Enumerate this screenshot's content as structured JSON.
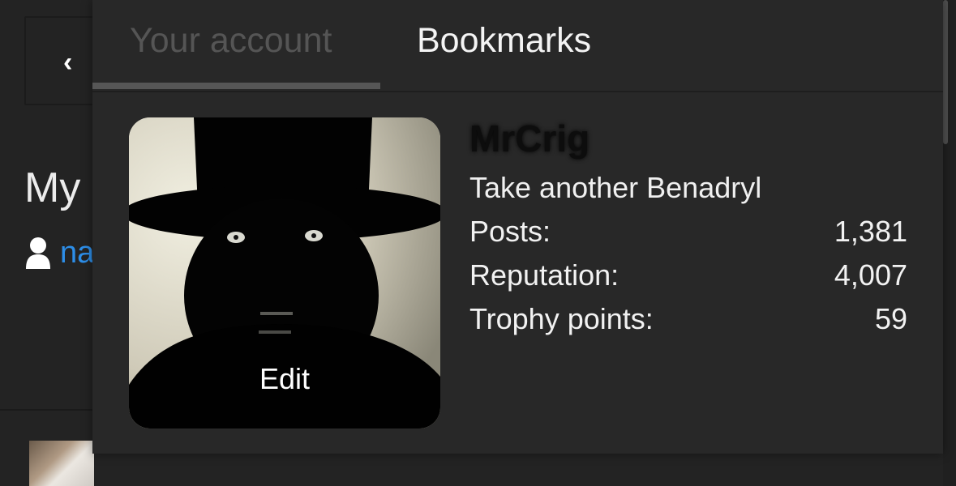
{
  "background": {
    "back_icon": "chevron-left-icon",
    "title": "My",
    "user_icon": "user-icon",
    "username": "na"
  },
  "tabs": [
    {
      "label": "Your account",
      "active": true
    },
    {
      "label": "Bookmarks",
      "active": false
    }
  ],
  "profile": {
    "username": "MrCrig",
    "user_title": "Take another Benadryl",
    "edit_label": "Edit",
    "stats": [
      {
        "label": "Posts:",
        "value": "1,381"
      },
      {
        "label": "Reputation:",
        "value": "4,007"
      },
      {
        "label": "Trophy points:",
        "value": "59"
      }
    ]
  },
  "colors": {
    "background": "#232323",
    "panel": "#282828",
    "link": "#2d8ee8",
    "inactive_tab": "#555555"
  }
}
